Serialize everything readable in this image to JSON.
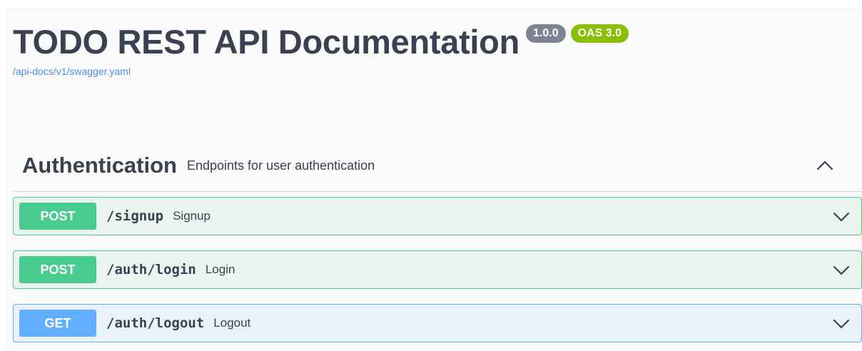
{
  "info": {
    "title": "TODO REST API Documentation",
    "version": "1.0.0",
    "oas_version": "OAS 3.0",
    "spec_url": "/api-docs/v1/swagger.yaml"
  },
  "tag": {
    "name": "Authentication",
    "description": "Endpoints for user authentication",
    "expanded": true,
    "toggle_icon": "chevron-up-icon"
  },
  "operations": [
    {
      "method": "POST",
      "path": "/signup",
      "summary": "Signup",
      "expand_icon": "chevron-down-icon"
    },
    {
      "method": "POST",
      "path": "/auth/login",
      "summary": "Login",
      "expand_icon": "chevron-down-icon"
    },
    {
      "method": "GET",
      "path": "/auth/logout",
      "summary": "Logout",
      "expand_icon": "chevron-down-icon"
    }
  ],
  "colors": {
    "text": "#3b4151",
    "link": "#4990e2",
    "version_badge": "#7d8492",
    "oas_badge": "#89bf04",
    "post": "#49cc90",
    "post_bg": "#ebf3ef",
    "get": "#61affe",
    "get_bg": "#ebf1f8"
  }
}
